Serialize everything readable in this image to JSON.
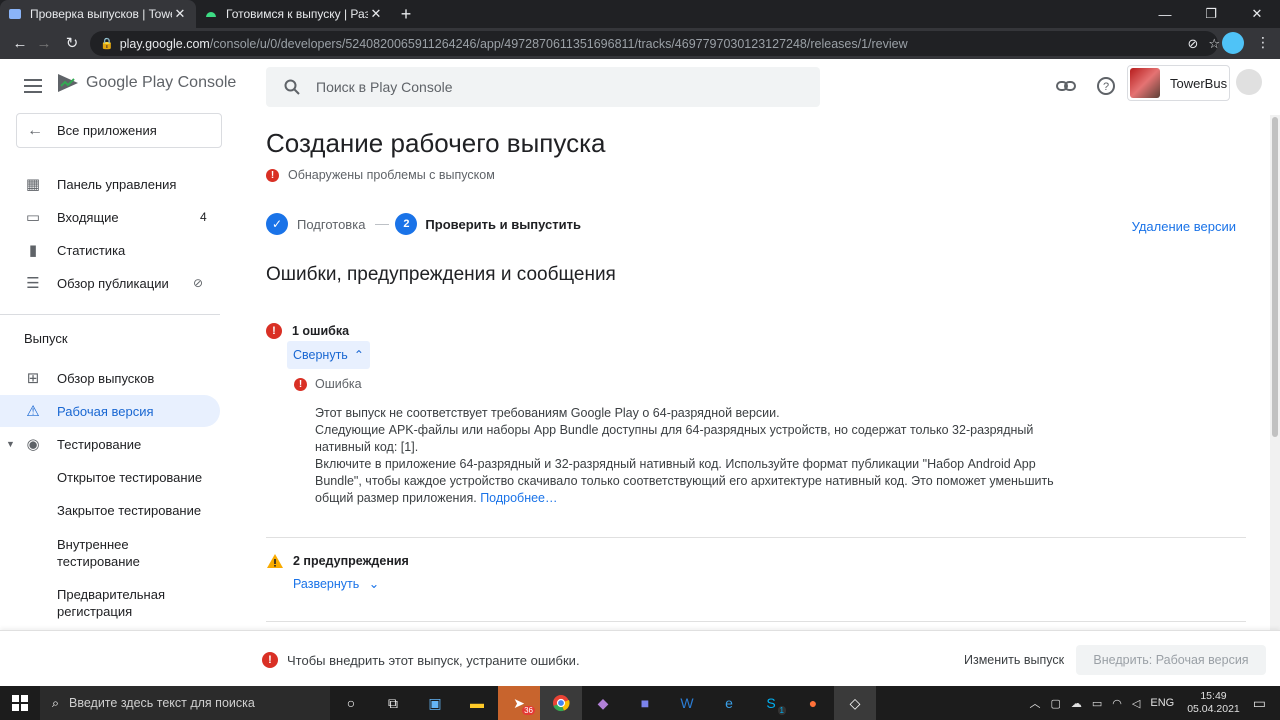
{
  "browser": {
    "tabs": [
      {
        "title": "Проверка выпусков | TowerBus",
        "close": "✕"
      },
      {
        "title": "Готовимся к выпуску | Разработ",
        "close": "✕"
      }
    ],
    "new_tab": "+",
    "url_host": "play.google.com",
    "url_path": "/console/u/0/developers/5240820065911264246/app/4972870611351696811/tracks/4697797030123127248/releases/1/review"
  },
  "header": {
    "logo_text": "Google Play Console",
    "search_placeholder": "Поиск в Play Console",
    "account_name": "TowerBus"
  },
  "sidebar": {
    "all_apps": "Все приложения",
    "top_items": [
      {
        "label": "Панель управления"
      },
      {
        "label": "Входящие",
        "badge": "4"
      },
      {
        "label": "Статистика"
      },
      {
        "label": "Обзор публикации"
      }
    ],
    "section_title": "Выпуск",
    "release_items": [
      {
        "label": "Обзор выпусков"
      },
      {
        "label": "Рабочая версия"
      },
      {
        "label": "Тестирование"
      }
    ],
    "testing_sub": [
      "Открытое тестирование",
      "Закрытое тестирование",
      "Внутреннее тестирование",
      "Предварительная регистрация"
    ]
  },
  "main": {
    "title": "Создание рабочего выпуска",
    "status": "Обнаружены проблемы с выпуском",
    "step1": "Подготовка",
    "step2_num": "2",
    "step2": "Проверить и выпустить",
    "delete_version": "Удаление версии",
    "section_title": "Ошибки, предупреждения и сообщения",
    "errors_count": "1 ошибка",
    "collapse": "Свернуть",
    "error_label": "Ошибка",
    "error_lines": [
      "Этот выпуск не соответствует требованиям Google Play о 64-разрядной версии.",
      "Следующие APK-файлы или наборы App Bundle доступны для 64-разрядных устройств, но содержат только 32-разрядный нативный код: [1].",
      "Включите в приложение 64-разрядный и 32-разрядный нативный код. Используйте формат публикации \"Набор Android App Bundle\", чтобы каждое устройство скачивало только соответствующий его архитектуре нативный код. Это поможет уменьшить общий размер приложения."
    ],
    "more_link": "Подробнее…",
    "warnings_count": "2 предупреждения",
    "expand": "Развернуть"
  },
  "bottom_bar": {
    "message": "Чтобы внедрить этот выпуск, устраните ошибки.",
    "change_release": "Изменить выпуск",
    "deploy": "Внедрить: Рабочая версия"
  },
  "taskbar": {
    "search_placeholder": "Введите здесь текст для поиска",
    "telegram_badge": "36",
    "skype_badge": "1",
    "lang": "ENG",
    "time": "15:49",
    "date": "05.04.2021"
  },
  "colors": {
    "accent": "#1a73e8",
    "error": "#d93025",
    "warning": "#f9ab00",
    "active_bg": "#e8f0fe"
  }
}
